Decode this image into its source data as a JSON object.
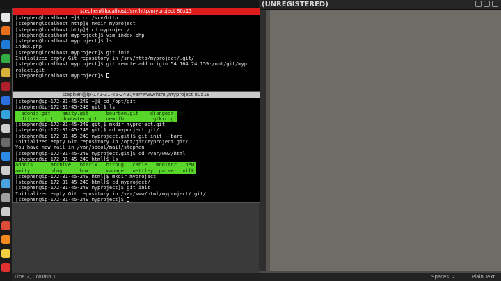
{
  "topbar": {
    "label": "(UNREGISTERED)"
  },
  "editor": {
    "title": "(UNREGISTERED)"
  },
  "statusbar": {
    "cursor": "Line 2, Column 1",
    "spaces": "Spaces: 2",
    "syntax": "Plain Text"
  },
  "term1": {
    "title": "stephen@localhost:/srv/http/myproject 80x13",
    "lines": [
      "[stephen@localhost ~]$ cd /srv/http",
      "[stephen@localhost http]$ mkdir myproject",
      "[stephen@localhost http]$ cd myproject/",
      "[stephen@localhost myproject]$ vim index.php",
      "[stephen@localhost myproject]$ ls",
      "index.php",
      "[stephen@localhost myproject]$ git init",
      "Initialized empty Git repository in /srv/http/myproject/.git/",
      "[stephen@localhost myproject]$ git remote add origin 54.164.24.159:/opt/git/myp",
      "roject.git",
      "[stephen@localhost myproject]$ "
    ]
  },
  "term2": {
    "title": "stephen@ip-172-31-45-249:/var/www/html/myproject 80x18",
    "lines": [
      "[stephen@ip-172-31-45-249 ~]$ cd /opt/git",
      "[stephen@ip-172-31-45-249 git]$ ls",
      "  adonis.git    amity.git      bourbon.git    djangoer.git",
      "  diftest.git   dumbster.git   newrfb         .gtkrc.git",
      "[stephen@ip-172-31-45-249 git]$ mkdir myproject.git",
      "[stephen@ip-172-31-45-249 git]$ cd myproject.git/",
      "[stephen@ip-172-31-45-249 myproject.git]$ git init --bare",
      "Initialized empty Git repository in /opt/git/myproject.git/",
      "You have new mail in /var/spool/mail/stephen",
      "[stephen@ip-172-31-45-249 myproject.git]$ cd /var/www/html",
      "[stephen@ip-172-31-45-249 html]$ ls",
      "adonis      archive   bitrix   bitbug   cable   monitor   new",
      "amity       blog      box      manager  nettley  parse   vilki",
      "[stephen@ip-172-31-45-249 html]$ mkdir myproject",
      "[stephen@ip-172-31-45-249 html]$ cd myproject/",
      "[stephen@ip-172-31-45-249 myproject]$ git init",
      "Initialized empty Git repository in /var/www/html/myproject/.git/",
      "[stephen@ip-172-31-45-249 myproject]$ "
    ]
  },
  "dock_icons": [
    {
      "name": "terminal-icon",
      "color": "#e8e8e8"
    },
    {
      "name": "app-s-icon",
      "color": "#e96f1b"
    },
    {
      "name": "code-icon",
      "color": "#1d7ad6"
    },
    {
      "name": "scanner-icon",
      "color": "#33aa44"
    },
    {
      "name": "folder-icon",
      "color": "#d8b23a"
    },
    {
      "name": "filezilla-icon",
      "color": "#b0202a"
    },
    {
      "name": "browser-icon",
      "color": "#2a6ee0"
    },
    {
      "name": "chat-icon",
      "color": "#34a3de"
    },
    {
      "name": "editor-icon",
      "color": "#cfcfcf"
    },
    {
      "name": "mail-icon",
      "color": "#6a6a6a"
    },
    {
      "name": "dropbox-icon",
      "color": "#2b8be6"
    },
    {
      "name": "camera-icon",
      "color": "#cfcfcf"
    },
    {
      "name": "settings-icon",
      "color": "#49a3e0"
    },
    {
      "name": "github-icon",
      "color": "#a0a0a0"
    },
    {
      "name": "tool-icon",
      "color": "#cccccc"
    },
    {
      "name": "chrome-icon",
      "color": "#dd4b39"
    },
    {
      "name": "firefox-icon",
      "color": "#f58a1f"
    },
    {
      "name": "notes-icon",
      "color": "#f0d040"
    },
    {
      "name": "power-icon",
      "color": "#e23030"
    }
  ]
}
